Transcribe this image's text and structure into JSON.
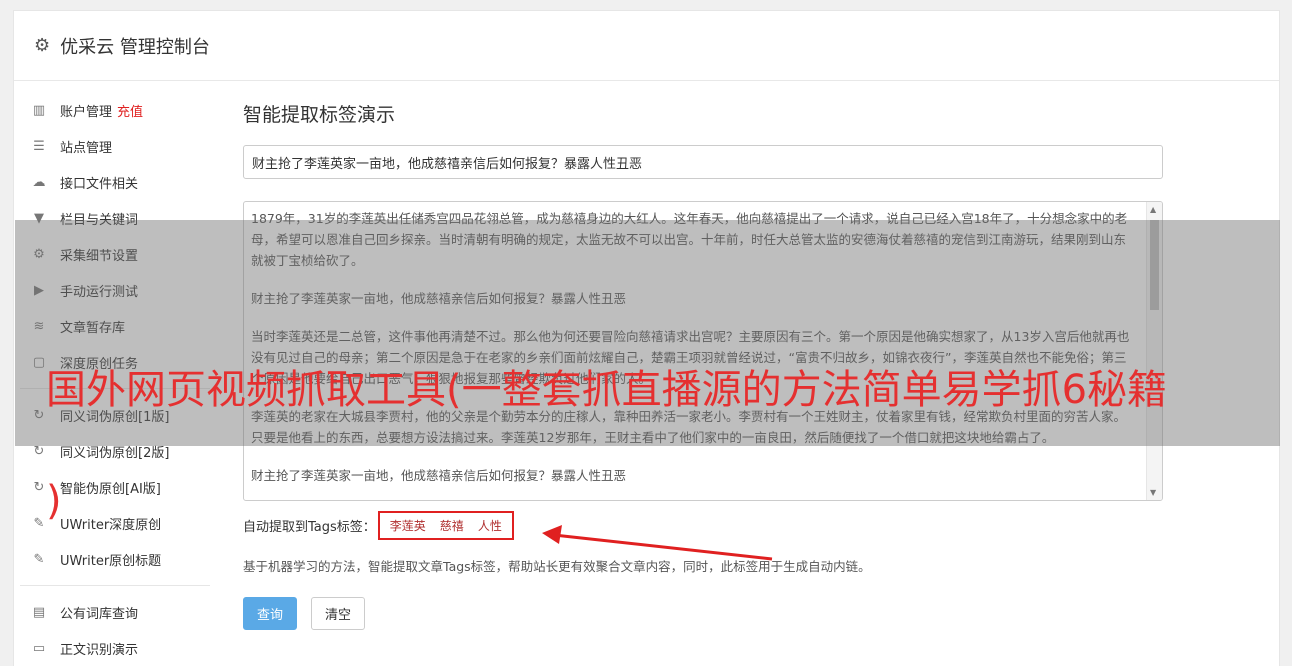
{
  "app": {
    "title": "优采云 管理控制台",
    "gear_icon": "gear-icon"
  },
  "sidebar": {
    "items": [
      {
        "label": "账户管理",
        "badge": "充值",
        "icon": "bar-chart-icon"
      },
      {
        "label": "站点管理",
        "icon": "server-icon"
      },
      {
        "label": "接口文件相关",
        "icon": "cloud-upload-icon"
      },
      {
        "label": "栏目与关键词",
        "icon": "filter-icon"
      },
      {
        "label": "采集细节设置",
        "icon": "cogs-icon"
      },
      {
        "label": "手动运行测试",
        "icon": "play-circle-icon"
      },
      {
        "label": "文章暂存库",
        "icon": "database-icon"
      },
      {
        "label": "深度原创任务",
        "icon": "file-icon"
      },
      {
        "label": "同义词伪原创[1版]",
        "icon": "refresh-icon"
      },
      {
        "label": "同义词伪原创[2版]",
        "icon": "refresh-icon"
      },
      {
        "label": "智能伪原创[AI版]",
        "icon": "refresh-icon"
      },
      {
        "label": "UWriter深度原创",
        "icon": "edit-icon"
      },
      {
        "label": "UWriter原创标题",
        "icon": "edit-icon"
      },
      {
        "label": "公有词库查询",
        "icon": "book-icon"
      },
      {
        "label": "正文识别演示",
        "icon": "window-icon"
      }
    ]
  },
  "main": {
    "heading": "智能提取标签演示",
    "title_value": "财主抢了李莲英家一亩地，他成慈禧亲信后如何报复？暴露人性丑恶",
    "content_paragraphs": [
      "1879年，31岁的李莲英出任储秀宫四品花翎总管，成为慈禧身边的大红人。这年春天，他向慈禧提出了一个请求，说自己已经入宫18年了，十分想念家中的老母，希望可以恩准自己回乡探亲。当时清朝有明确的规定，太监无故不可以出宫。十年前，时任大总管太监的安德海仗着慈禧的宠信到江南游玩，结果刚到山东就被丁宝桢给砍了。",
      "财主抢了李莲英家一亩地，他成慈禧亲信后如何报复？暴露人性丑恶",
      "当时李莲英还是二总管，这件事他再清楚不过。那么他为何还要冒险向慈禧请求出宫呢？主要原因有三个。第一个原因是他确实想家了，从13岁入宫后他就再也没有见过自己的母亲；第二个原因是急于在老家的乡亲们面前炫耀自己，楚霸王项羽就曾经说过，“富贵不归故乡，如锦衣夜行”，李莲英自然也不能免俗；第三个原因是他要给自己出口恶气，狠狠地报复那些曾经欺负过他们家的人。",
      "李莲英的老家在大城县李贾村，他的父亲是个勤劳本分的庄稼人，靠种田养活一家老小。李贾村有一个王姓财主，仗着家里有钱，经常欺负村里面的穷苦人家。只要是他看上的东西，总要想方设法搞过来。李莲英12岁那年，王财主看中了他们家中的一亩良田，然后随便找了一个借口就把这块地给霸占了。",
      "财主抢了李莲英家一亩地，他成慈禧亲信后如何报复？暴露人性丑恶"
    ],
    "tags_label": "自动提取到Tags标签：",
    "tags": [
      "李莲英",
      "慈禧",
      "人性"
    ],
    "description": "基于机器学习的方法，智能提取文章Tags标签，帮助站长更有效聚合文章内容，同时，此标签用于生成自动内链。",
    "query_button": "查询",
    "clear_button": "清空"
  },
  "overlay": {
    "line1": "国外网页视频抓取工具(一整套抓直播源的方法简单易学抓6秘籍",
    "line2": ")"
  },
  "colors": {
    "accent": "#5aa9e6",
    "highlight": "#e02020"
  }
}
